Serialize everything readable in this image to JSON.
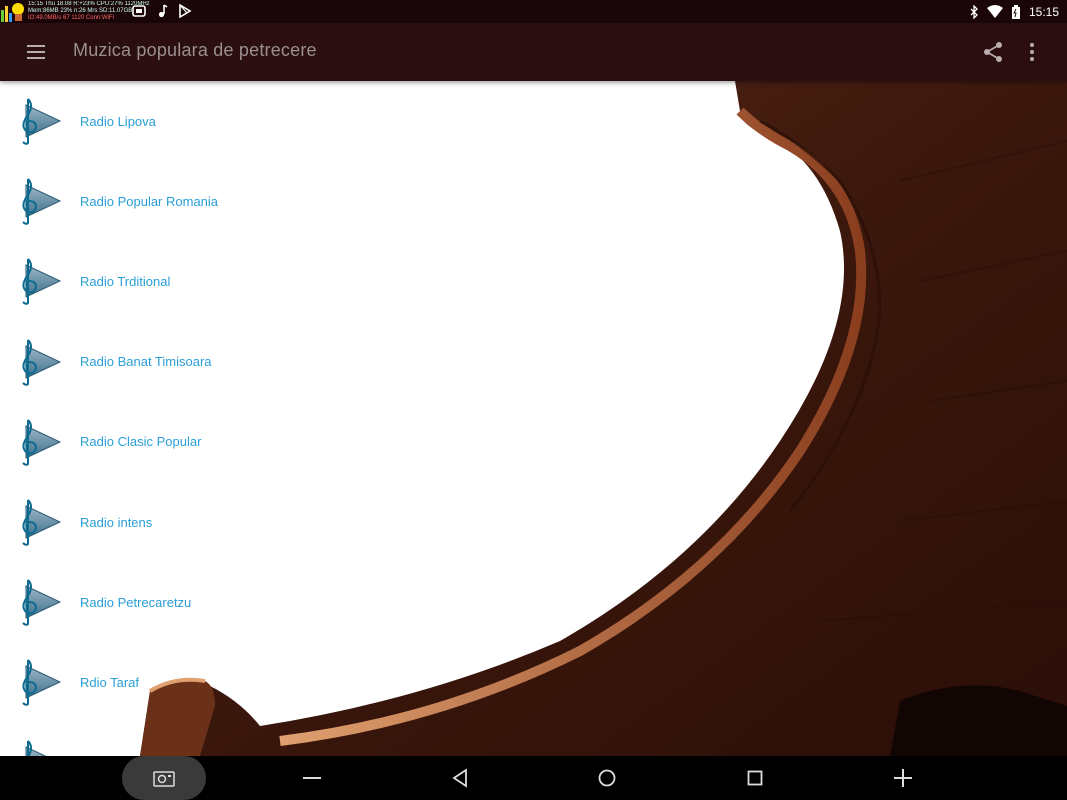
{
  "status_bar": {
    "time": "15:15",
    "overlay_lines": [
      "15:15 Thu 18.08 R:+23% CPU:27% 1120MHz",
      "Mem:86MB 23% n:26 Mrs SD:11.07GB",
      "IO:49.0MB/s 67 1120 Conn:WiFi"
    ]
  },
  "app_bar": {
    "title": "Muzica populara de petrecere"
  },
  "stations": [
    {
      "label": "Radio Lipova"
    },
    {
      "label": "Radio Popular Romania"
    },
    {
      "label": "Radio Trditional"
    },
    {
      "label": "Radio Banat Timisoara"
    },
    {
      "label": "Radio Clasic Popular"
    },
    {
      "label": "Radio intens"
    },
    {
      "label": "Radio Petrecaretzu"
    },
    {
      "label": "Rdio Taraf"
    },
    {
      "label": ""
    }
  ],
  "icons": {
    "menu": "hamburger-menu-icon",
    "share": "share-icon",
    "more": "overflow-menu-icon",
    "station": "treble-clef-play-icon"
  },
  "colors": {
    "app_bar": "#2b0e10",
    "status_bar": "#1a0608",
    "link": "#2a9fd6"
  }
}
